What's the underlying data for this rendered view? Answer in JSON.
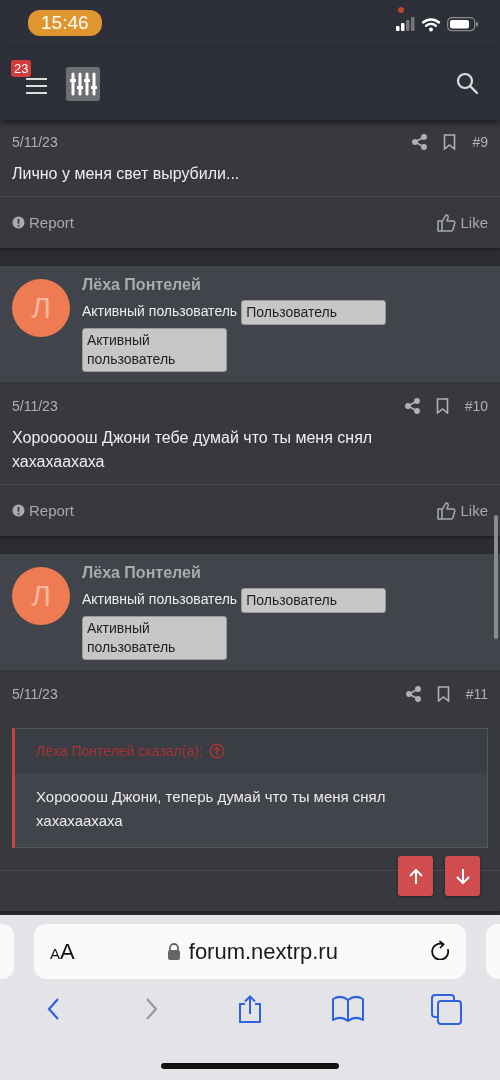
{
  "status_bar": {
    "time": "15:46"
  },
  "header": {
    "notification_count": "23"
  },
  "posts": [
    {
      "date": "5/11/23",
      "number": "#9",
      "message": "Лично у меня свет вырубили...",
      "footer": {
        "report": "Report",
        "like": "Like"
      }
    },
    {
      "author": {
        "avatar_letter": "Л",
        "name": "Лёха Понтелей",
        "title": "Активный пользователь",
        "banners": [
          "Пользователь",
          "Активный пользователь"
        ]
      },
      "date": "5/11/23",
      "number": "#10",
      "message": "Хорооооош Джони тебе думай что ты меня снял хахахаахаха",
      "footer": {
        "report": "Report",
        "like": "Like"
      }
    },
    {
      "author": {
        "avatar_letter": "Л",
        "name": "Лёха Понтелей",
        "title": "Активный пользователь",
        "banners": [
          "Пользователь",
          "Активный пользователь"
        ]
      },
      "date": "5/11/23",
      "number": "#11",
      "quote": {
        "attribution": "Лёха Понтелей сказал(а):",
        "text": "Хороооош Джони, теперь думай что ты меня снял хахахаахаха"
      }
    }
  ],
  "browser": {
    "text_size_button": "AA",
    "url": "forum.nextrp.ru"
  }
}
